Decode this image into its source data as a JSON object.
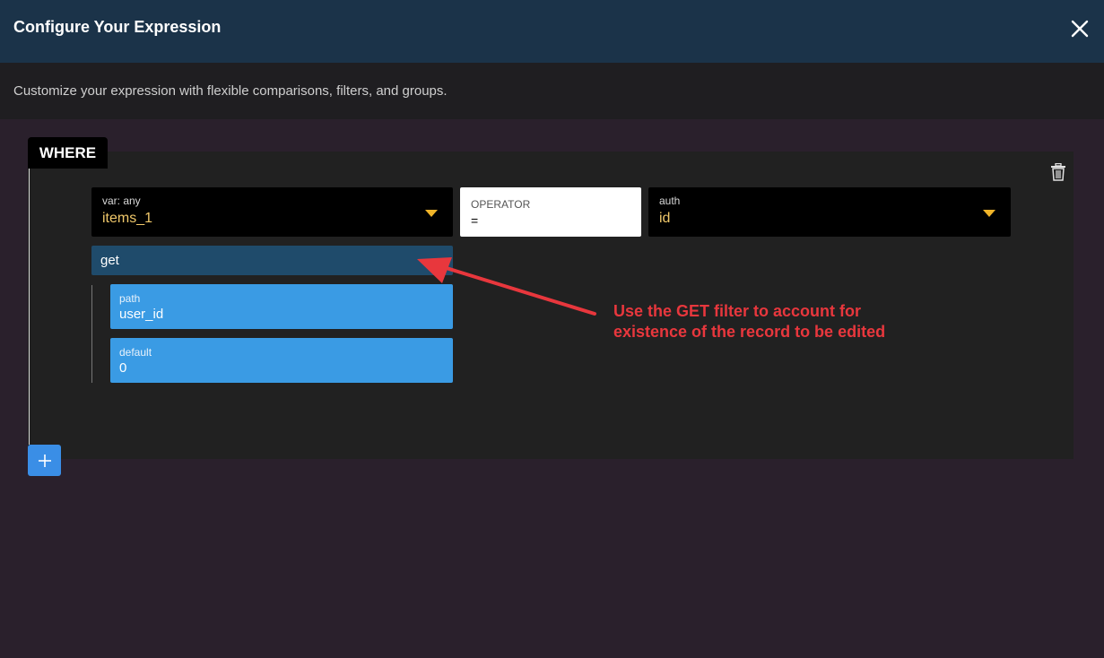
{
  "header": {
    "title": "Configure Your Expression",
    "close_icon": "close-icon"
  },
  "subheader": {
    "description": "Customize your expression with flexible comparisons, filters, and groups."
  },
  "clause": {
    "tag": "WHERE",
    "delete_icon": "trash-icon",
    "left": {
      "label": "var: any",
      "value": "items_1"
    },
    "operator": {
      "label": "OPERATOR",
      "value": "="
    },
    "right": {
      "label": "auth",
      "value": "id"
    },
    "filter": {
      "name": "get",
      "args": [
        {
          "label": "path",
          "value": "user_id"
        },
        {
          "label": "default",
          "value": "0"
        }
      ]
    },
    "add_icon": "plus-icon"
  },
  "annotation": {
    "line1": "Use the GET filter to account for",
    "line2": "existence of the record to be edited",
    "color": "#e8373d"
  },
  "colors": {
    "header_bg": "#1b3349",
    "page_bg": "#2a202c",
    "value_text": "#f0c86a",
    "caret": "#f0b429",
    "filter_bg": "#1f4b6b",
    "arg_bg": "#3a9be4",
    "add_button": "#3a8ee6"
  }
}
